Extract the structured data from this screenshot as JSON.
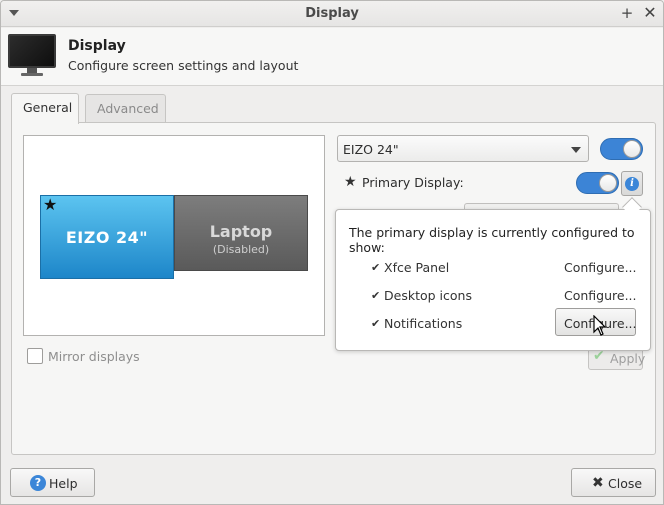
{
  "window": {
    "title": "Display"
  },
  "header": {
    "title": "Display",
    "subtitle": "Configure screen settings and layout"
  },
  "tabs": [
    {
      "label": "General",
      "active": true
    },
    {
      "label": "Advanced",
      "active": false
    }
  ],
  "layout": {
    "displays": [
      {
        "name": "EIZO 24\"",
        "status": "",
        "primary": true
      },
      {
        "name": "Laptop",
        "status": "(Disabled)",
        "primary": false
      }
    ]
  },
  "mirror": {
    "label": "Mirror displays",
    "checked": false
  },
  "display_select": {
    "value": "EIZO 24\""
  },
  "display_enabled": true,
  "primary": {
    "label": "Primary Display:",
    "enabled": true
  },
  "popover": {
    "intro": "The primary display is currently configured to show:",
    "rows": [
      {
        "label": "Xfce Panel",
        "action": "Configure..."
      },
      {
        "label": "Desktop icons",
        "action": "Configure..."
      },
      {
        "label": "Notifications",
        "action": "Configure..."
      }
    ]
  },
  "apply_label": "Apply",
  "footer": {
    "help_label": "Help",
    "close_label": "Close"
  },
  "colors": {
    "accent": "#3c84d6",
    "primary_display": "#2a9ee0",
    "disabled_display": "#6b6b6b"
  }
}
